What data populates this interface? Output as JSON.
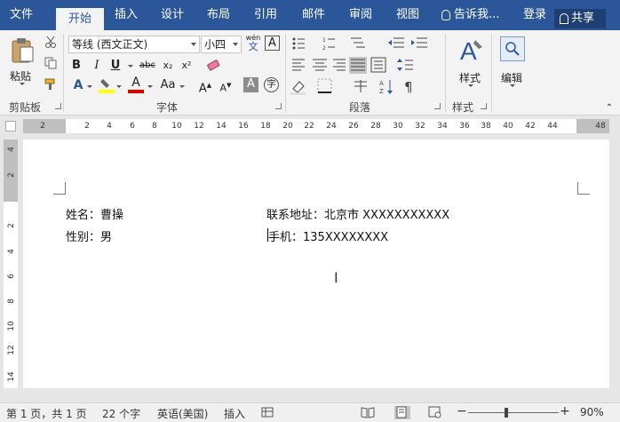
{
  "tabs": [
    {
      "label": "文件"
    },
    {
      "label": "开始"
    },
    {
      "label": "插入"
    },
    {
      "label": "设计"
    },
    {
      "label": "布局"
    },
    {
      "label": "引用"
    },
    {
      "label": "邮件"
    },
    {
      "label": "审阅"
    },
    {
      "label": "视图"
    }
  ],
  "active_tab": "开始",
  "tell_me": "告诉我...",
  "login": "登录",
  "share": "共享",
  "ribbon": {
    "clipboard": {
      "paste_label": "粘贴",
      "group_label": "剪贴板"
    },
    "font": {
      "font_name": "等线 (西文正文)",
      "font_size": "小四",
      "wen_label": "wén",
      "wen_char": "文",
      "bold": "B",
      "italic": "I",
      "underline": "U",
      "strike": "abc",
      "sub": "x₂",
      "sup": "x²",
      "case": "Aa",
      "grow": "A",
      "shrink": "A",
      "group_label": "字体"
    },
    "paragraph": {
      "group_label": "段落"
    },
    "styles": {
      "label": "样式",
      "group_label": "样式"
    },
    "editing": {
      "label": "编辑"
    }
  },
  "ruler": {
    "h_ticks": [
      "2",
      "2",
      "4",
      "6",
      "8",
      "10",
      "12",
      "14",
      "16",
      "18",
      "20",
      "22",
      "24",
      "26",
      "28",
      "30",
      "32",
      "34",
      "36",
      "38",
      "40",
      "42",
      "44",
      "48"
    ],
    "v_ticks": [
      "4",
      "2",
      "2",
      "4",
      "6",
      "8",
      "10",
      "12",
      "14"
    ]
  },
  "document": {
    "lines": [
      {
        "left": "姓名：曹操",
        "right": "联系地址：北京市 XXXXXXXXXXX"
      },
      {
        "left": "性别：男",
        "right": "手机：135XXXXXXXX"
      }
    ]
  },
  "status": {
    "page": "第 1 页，共 1 页",
    "words": "22 个字",
    "language": "英语(美国)",
    "mode": "插入",
    "zoom": "90%",
    "zoom_minus": "−",
    "zoom_plus": "+"
  },
  "colors": {
    "brand": "#2b579a",
    "highlight": "#ffff00",
    "font_color": "#e00000"
  }
}
